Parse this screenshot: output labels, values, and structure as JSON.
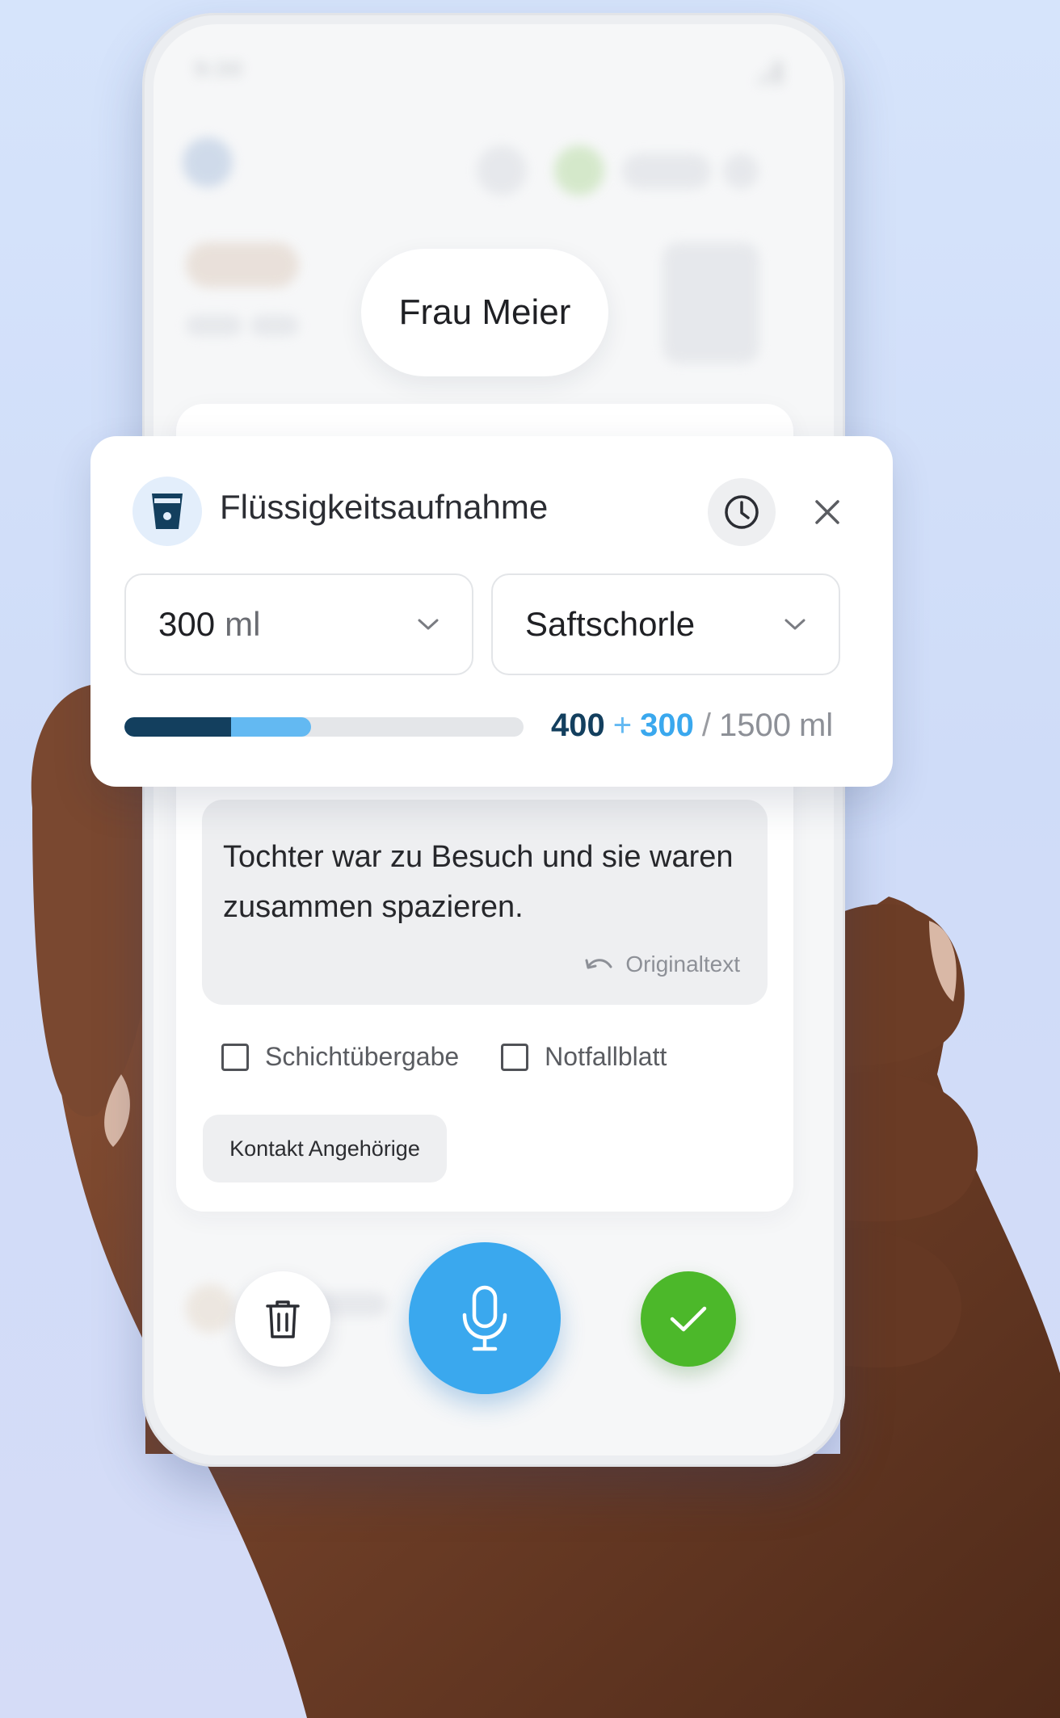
{
  "status_bar": {
    "time": "9:30"
  },
  "patient": {
    "name": "Frau Meier"
  },
  "popup": {
    "title": "Flüssigkeitsaufnahme",
    "amount_select": {
      "value": "300",
      "unit": "ml"
    },
    "drink_select": {
      "value": "Saftschorle"
    },
    "progress": {
      "current": "400",
      "plus": "+",
      "added": "300",
      "separator": "/",
      "goal": "1500",
      "unit": "ml",
      "current_fraction": 0.2667,
      "added_fraction": 0.2
    },
    "colors": {
      "current": "#133f5e",
      "added": "#63b9f2",
      "track": "#e4e6e9"
    }
  },
  "note": {
    "text": "Tochter war zu Besuch und sie waren zusammen spazieren.",
    "original_link": "Originaltext"
  },
  "checkboxes": [
    {
      "label": "Schichtübergabe",
      "checked": false
    },
    {
      "label": "Notfallblatt",
      "checked": false
    }
  ],
  "chip": {
    "label": "Kontakt Angehörige"
  },
  "actions": {
    "mic_color": "#3aa8ee",
    "confirm_color": "#4cb82a"
  }
}
